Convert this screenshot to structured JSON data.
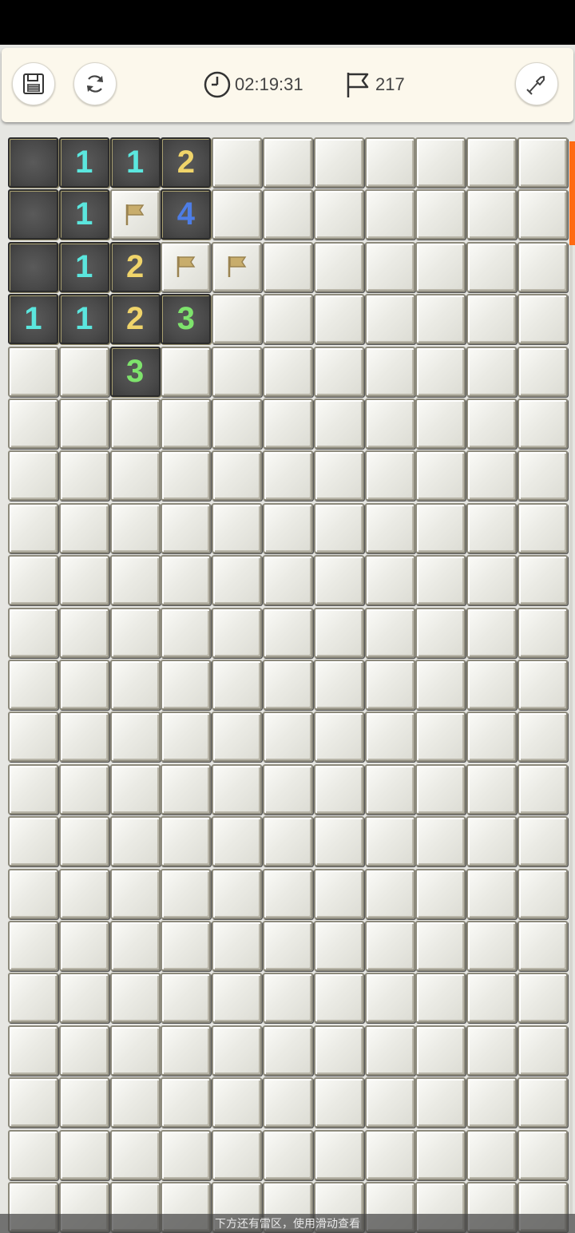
{
  "toolbar": {
    "save_icon": "save-icon",
    "restart_icon": "restart-icon",
    "timer_icon": "clock-icon",
    "timer_value": "02:19:31",
    "flag_icon": "flag-icon",
    "flags_remaining": "217",
    "dig_icon": "shovel-icon"
  },
  "board": {
    "columns": 11,
    "visible_rows": 21,
    "revealed": [
      {
        "r": 0,
        "c": 0,
        "v": ""
      },
      {
        "r": 0,
        "c": 1,
        "v": "1"
      },
      {
        "r": 0,
        "c": 2,
        "v": "1"
      },
      {
        "r": 0,
        "c": 3,
        "v": "2"
      },
      {
        "r": 1,
        "c": 0,
        "v": ""
      },
      {
        "r": 1,
        "c": 1,
        "v": "1"
      },
      {
        "r": 1,
        "c": 3,
        "v": "4"
      },
      {
        "r": 2,
        "c": 0,
        "v": ""
      },
      {
        "r": 2,
        "c": 1,
        "v": "1"
      },
      {
        "r": 2,
        "c": 2,
        "v": "2"
      },
      {
        "r": 3,
        "c": 0,
        "v": "1"
      },
      {
        "r": 3,
        "c": 1,
        "v": "1"
      },
      {
        "r": 3,
        "c": 2,
        "v": "2"
      },
      {
        "r": 3,
        "c": 3,
        "v": "3"
      },
      {
        "r": 4,
        "c": 2,
        "v": "3"
      }
    ],
    "flagged": [
      {
        "r": 1,
        "c": 2
      },
      {
        "r": 2,
        "c": 3
      },
      {
        "r": 2,
        "c": 4
      }
    ],
    "number_colors": {
      "1": "#5be6de",
      "2": "#f0d46a",
      "3": "#7ee36c",
      "4": "#4d7de6"
    }
  },
  "hint": {
    "text": "下方还有雷区，使用滑动查看"
  }
}
